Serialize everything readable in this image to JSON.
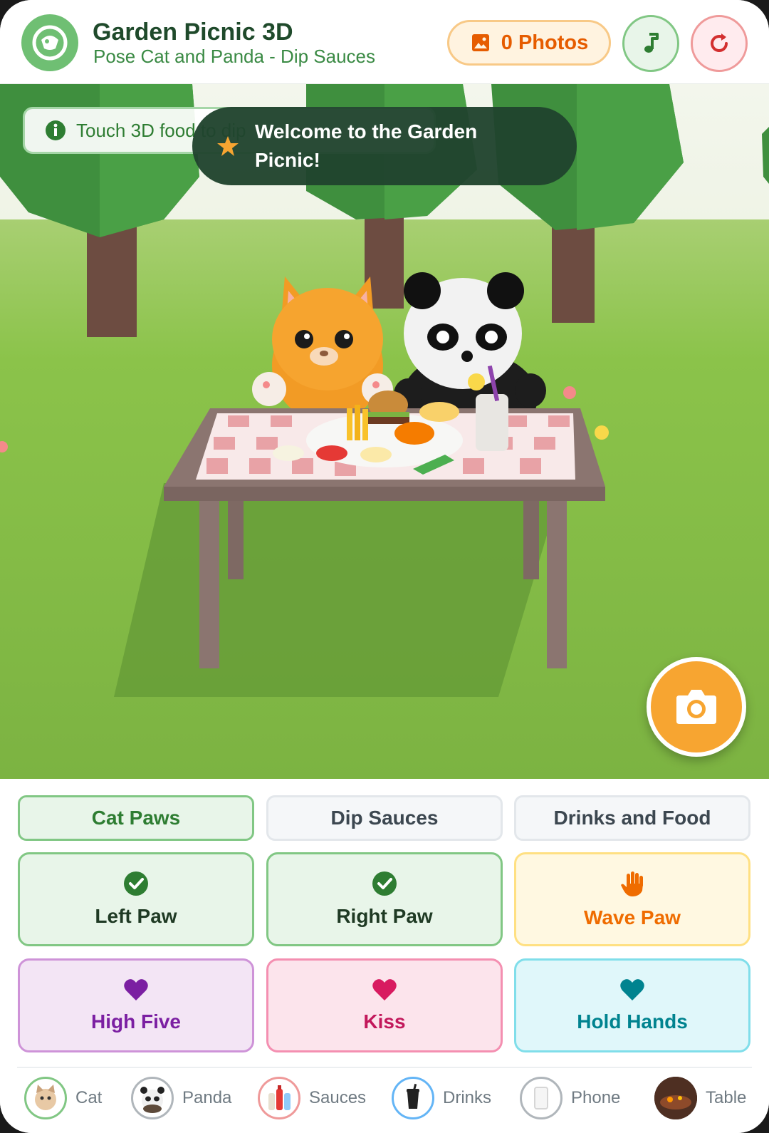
{
  "header": {
    "title": "Garden Picnic 3D",
    "subtitle": "Pose Cat and Panda - Dip Sauces",
    "photos_label": "0 Photos"
  },
  "scene": {
    "hint_text": "Touch 3D food to dip",
    "toast_text": "Welcome to the Garden Picnic!"
  },
  "tabs": [
    {
      "label": "Cat Paws",
      "active": true
    },
    {
      "label": "Dip Sauces",
      "active": false
    },
    {
      "label": "Drinks and Food",
      "active": false
    }
  ],
  "actions": [
    {
      "label": "Left Paw",
      "icon": "check-circle-icon",
      "state": "checked"
    },
    {
      "label": "Right Paw",
      "icon": "check-circle-icon",
      "state": "checked"
    },
    {
      "label": "Wave Paw",
      "icon": "hand-icon"
    },
    {
      "label": "High Five",
      "icon": "heart-icon"
    },
    {
      "label": "Kiss",
      "icon": "heart-icon"
    },
    {
      "label": "Hold Hands",
      "icon": "heart-icon"
    }
  ],
  "nav": [
    {
      "label": "Cat"
    },
    {
      "label": "Panda"
    },
    {
      "label": "Sauces"
    },
    {
      "label": "Drinks"
    },
    {
      "label": "Phone"
    },
    {
      "label": "Table"
    }
  ],
  "colors": {
    "primary_green": "#6fbf73",
    "accent_orange": "#f7a531",
    "grass": "#7cb342"
  }
}
